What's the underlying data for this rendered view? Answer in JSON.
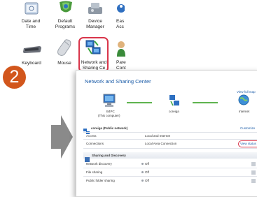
{
  "control_panel": {
    "items_row1": [
      {
        "label_lines": [
          "Date and",
          "Time"
        ]
      },
      {
        "label_lines": [
          "Default",
          "Programs"
        ]
      },
      {
        "label_lines": [
          "Device",
          "Manager"
        ]
      },
      {
        "label_lines": [
          "Eas",
          "Acc"
        ]
      }
    ],
    "items_row2": [
      {
        "label_lines": [
          "Keyboard"
        ]
      },
      {
        "label_lines": [
          "Mouse"
        ]
      },
      {
        "label_lines": [
          "Network and",
          "Sharing Ce"
        ]
      },
      {
        "label_lines": [
          "Pare",
          "Cont"
        ]
      }
    ]
  },
  "step_number": "2",
  "network_center": {
    "title": "Network and Sharing Center",
    "view_full_map": "View full map",
    "map": {
      "pc_name": "B4PC",
      "pc_sub": "(This computer)",
      "network_name": "coreiga",
      "internet_label": "Internet"
    },
    "network_section": {
      "title": "coreiga (Public network)",
      "customize": "Customize",
      "rows": [
        {
          "label": "Access",
          "value": "Local and Internet",
          "link": ""
        },
        {
          "label": "Connections",
          "value": "Local Area Connection",
          "link": "View status"
        }
      ]
    },
    "sharing_section": {
      "title": "Sharing and Discovery",
      "rows": [
        {
          "label": "Network discovery",
          "value": "Off"
        },
        {
          "label": "File sharing",
          "value": "Off"
        },
        {
          "label": "Public folder sharing",
          "value": "Off"
        }
      ]
    }
  },
  "colors": {
    "step_badge": "#d2561c",
    "highlight": "#d9354a",
    "link": "#1b5ca8",
    "arrow": "#8a8a8a"
  }
}
